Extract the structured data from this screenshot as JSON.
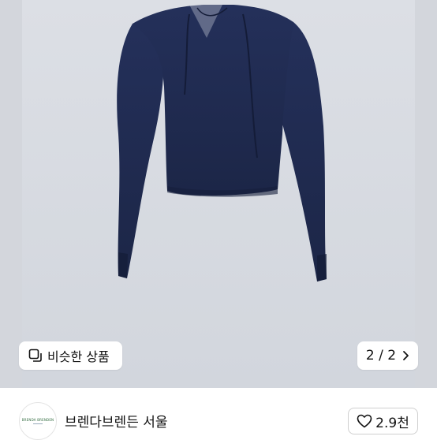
{
  "product": {
    "similar_label": "비슷한 상품",
    "pager": {
      "current": "2",
      "separator": "/",
      "total": "2",
      "text": "2 / 2"
    }
  },
  "seller": {
    "name": "브렌다브렌든 서울",
    "avatar_logo_text": "BRENDA BRENDEN",
    "likes": "2.9천"
  },
  "colors": {
    "sweater": "#1f2a4d",
    "background": "#d5d8de",
    "heart_outline": "#111111"
  },
  "icons": {
    "similar": "similar-items-icon",
    "pager_next": "chevron-right-icon",
    "like": "heart-outline-icon"
  }
}
